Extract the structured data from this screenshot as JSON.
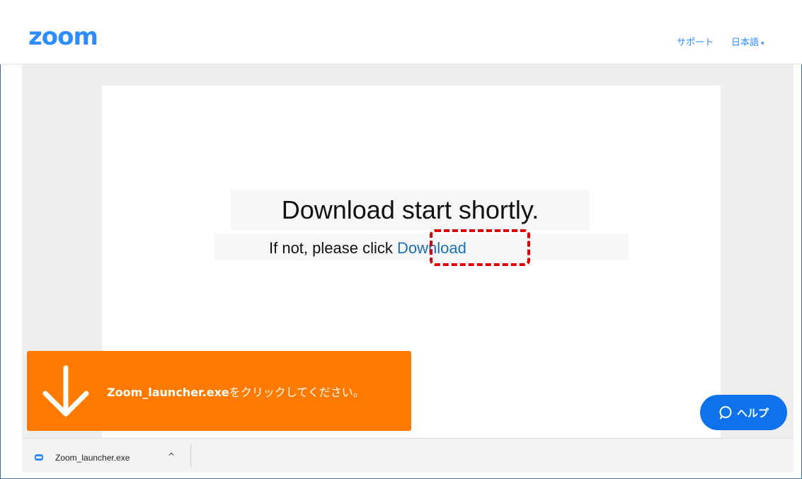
{
  "header": {
    "logo": "zoom",
    "nav_support": "サポート",
    "nav_language": "日本語",
    "caret": "▾"
  },
  "main": {
    "headline": "Download start shortly.",
    "subline_prefix": "If not, please click ",
    "download_link": "Download"
  },
  "toast": {
    "filename_bold": "Zoom_launcher.exe",
    "instruction": "をクリックしてください。",
    "icon": "arrow-down-icon"
  },
  "help": {
    "label": "ヘルプ",
    "icon": "chat-bubble-icon"
  },
  "download_bar": {
    "filename": "Zoom_launcher.exe",
    "chevron": "^",
    "file_icon": "zoom-file-icon"
  },
  "colors": {
    "brand_blue": "#2d8cff",
    "toast_orange": "#ff7a00",
    "help_blue": "#0e72ed",
    "highlight_red": "#e00000"
  }
}
